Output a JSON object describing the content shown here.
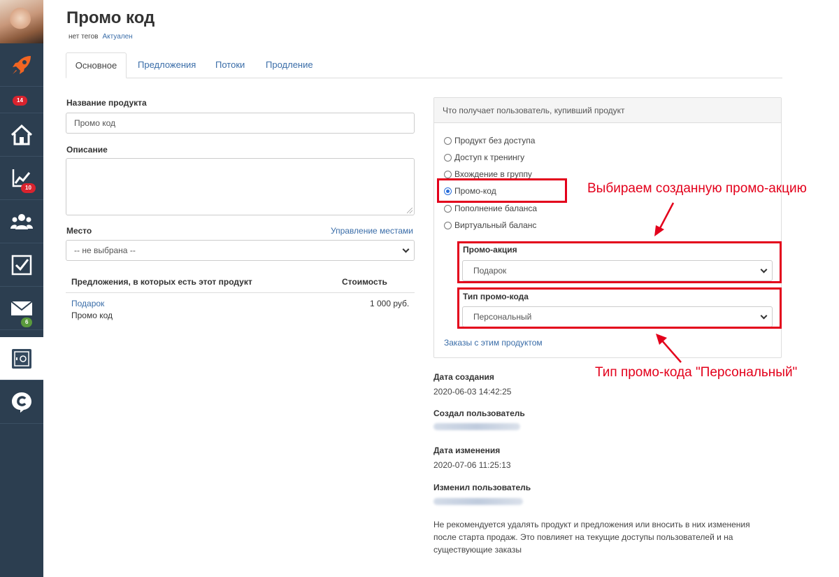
{
  "sidebar": {
    "items": [
      {
        "name": "rocket",
        "badge": ""
      },
      {
        "name": "home",
        "badge": "14"
      },
      {
        "name": "chart",
        "badge": "10"
      },
      {
        "name": "users",
        "badge": ""
      },
      {
        "name": "tasks",
        "badge": ""
      },
      {
        "name": "mail",
        "badge": "6"
      },
      {
        "name": "products",
        "badge": ""
      },
      {
        "name": "chat",
        "badge": ""
      }
    ]
  },
  "header": {
    "title": "Промо код",
    "tags": "нет тегов",
    "status": "Актуален"
  },
  "tabs": [
    {
      "label": "Основное",
      "active": true
    },
    {
      "label": "Предложения",
      "active": false
    },
    {
      "label": "Потоки",
      "active": false
    },
    {
      "label": "Продление",
      "active": false
    }
  ],
  "form": {
    "name_label": "Название продукта",
    "name_value": "Промо код",
    "description_label": "Описание",
    "place_label": "Место",
    "place_manage_link": "Управление местами",
    "place_value": "-- не выбрана --"
  },
  "offers_table": {
    "col_offers": "Предложения, в которых есть этот продукт",
    "col_price": "Стоимость",
    "rows": [
      {
        "offer_link": "Подарок",
        "product": "Промо код",
        "price": "1 000 руб."
      }
    ]
  },
  "panel": {
    "heading": "Что получает пользователь, купивший продукт",
    "options": [
      {
        "label": "Продукт без доступа",
        "checked": false
      },
      {
        "label": "Доступ к тренингу",
        "checked": false
      },
      {
        "label": "Вхождение в группу",
        "checked": false
      },
      {
        "label": "Промо-код",
        "checked": true
      },
      {
        "label": "Пополнение баланса",
        "checked": false
      },
      {
        "label": "Виртуальный баланс",
        "checked": false
      }
    ],
    "promo_label": "Промо-акция",
    "promo_value": "Подарок",
    "promo_type_label": "Тип промо-кода",
    "promo_type_value": "Персональный",
    "orders_link": "Заказы с этим продуктом"
  },
  "info": {
    "created_label": "Дата создания",
    "created_value": "2020-06-03 14:42:25",
    "creator_label": "Создал пользователь",
    "modified_label": "Дата изменения",
    "modified_value": "2020-07-06 11:25:13",
    "modifier_label": "Изменил пользователь",
    "note": "Не рекомендуется удалять продукт и предложения или вносить в них изменения после старта продаж. Это повлияет на текущие доступы пользователей и на существующие заказы"
  },
  "annotations": {
    "top": "Выбираем созданную промо-акцию",
    "bottom": "Тип промо-кода \"Персональный\""
  },
  "colors": {
    "sidebar_bg": "#2c3e50",
    "link": "#3a6da8",
    "annotation_red": "#e3001b",
    "badge_red": "#d9232e",
    "badge_green": "#5a9a3c"
  }
}
